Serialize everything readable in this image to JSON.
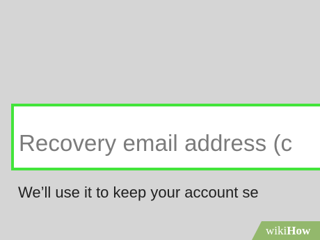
{
  "recovery_field": {
    "placeholder": "Recovery email address (c",
    "highlight_color": "#43e43b"
  },
  "helper": {
    "text": "We’ll use it to keep your account se"
  },
  "watermark": {
    "prefix": "wiki",
    "suffix": "How",
    "background": "#93b86c"
  },
  "background_color": "#d5d5d5"
}
